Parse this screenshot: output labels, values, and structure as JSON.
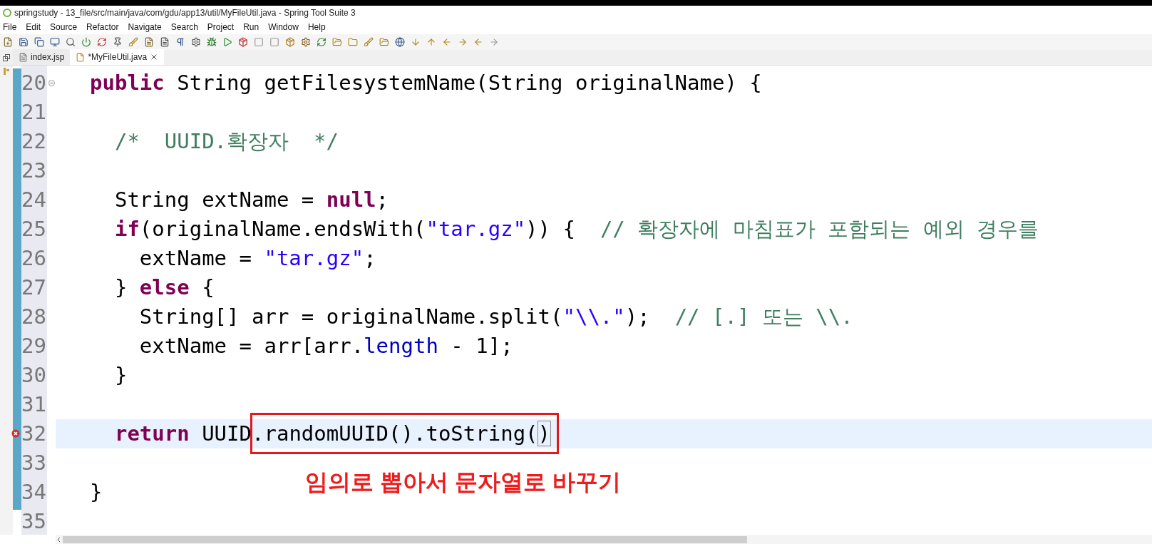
{
  "window": {
    "title": "springstudy - 13_file/src/main/java/com/gdu/app13/util/MyFileUtil.java - Spring Tool Suite 3"
  },
  "menu": [
    "File",
    "Edit",
    "Source",
    "Refactor",
    "Navigate",
    "Search",
    "Project",
    "Run",
    "Window",
    "Help"
  ],
  "tabs": [
    {
      "label": "index.jsp",
      "selected": false,
      "kind": "jsp"
    },
    {
      "label": "*MyFileUtil.java",
      "selected": true,
      "kind": "java"
    }
  ],
  "lines": [
    {
      "number": "20",
      "fold": true,
      "error": false,
      "current": false,
      "tokens": [
        {
          "t": "public",
          "kind": "keyword"
        },
        {
          "t": " String getFilesystemName(String originalName) {",
          "kind": "plain"
        }
      ]
    },
    {
      "number": "21",
      "fold": false,
      "error": false,
      "current": false
    },
    {
      "number": "22",
      "fold": false,
      "error": false,
      "current": false,
      "tokens": [
        {
          "t": "  /*  UUID.확장자  */",
          "kind": "comment"
        }
      ]
    },
    {
      "number": "23",
      "fold": false,
      "error": false,
      "current": false
    },
    {
      "number": "24",
      "fold": false,
      "error": false,
      "current": false,
      "tokens": [
        {
          "t": "  String extName = ",
          "kind": "plain"
        },
        {
          "t": "null",
          "kind": "keyword"
        },
        {
          "t": ";",
          "kind": "plain"
        }
      ]
    },
    {
      "number": "25",
      "fold": false,
      "error": false,
      "current": false,
      "tokens": [
        {
          "t": "  if",
          "kind": "keyword"
        },
        {
          "t": "(originalName.endsWith(",
          "kind": "plain"
        },
        {
          "t": "\"tar.gz\"",
          "kind": "string"
        },
        {
          "t": ")) {  ",
          "kind": "plain"
        },
        {
          "t": "// 확장자에 마침표가 포함되는 예외 경우를",
          "kind": "comment"
        }
      ]
    },
    {
      "number": "26",
      "fold": false,
      "error": false,
      "current": false,
      "tokens": [
        {
          "t": "    extName = ",
          "kind": "plain"
        },
        {
          "t": "\"tar.gz\"",
          "kind": "string"
        },
        {
          "t": ";",
          "kind": "plain"
        }
      ]
    },
    {
      "number": "27",
      "fold": false,
      "error": false,
      "current": false,
      "tokens": [
        {
          "t": "  } ",
          "kind": "plain"
        },
        {
          "t": "else",
          "kind": "keyword"
        },
        {
          "t": " {",
          "kind": "plain"
        }
      ]
    },
    {
      "number": "28",
      "fold": false,
      "error": false,
      "current": false,
      "tokens": [
        {
          "t": "    String[] arr = originalName.split(",
          "kind": "plain"
        },
        {
          "t": "\"\\\\.\"",
          "kind": "string"
        },
        {
          "t": ");  ",
          "kind": "plain"
        },
        {
          "t": "// [.] 또는 \\\\.",
          "kind": "comment"
        }
      ]
    },
    {
      "number": "29",
      "fold": false,
      "error": false,
      "current": false,
      "tokens": [
        {
          "t": "    extName = arr[arr.",
          "kind": "plain"
        },
        {
          "t": "length",
          "kind": "field"
        },
        {
          "t": " - 1];",
          "kind": "plain"
        }
      ]
    },
    {
      "number": "30",
      "fold": false,
      "error": false,
      "current": false,
      "tokens": [
        {
          "t": "  }",
          "kind": "plain"
        }
      ]
    },
    {
      "number": "31",
      "fold": false,
      "error": false,
      "current": false
    },
    {
      "number": "32",
      "fold": false,
      "error": true,
      "current": true,
      "tokens": [
        {
          "t": "  return",
          "kind": "keyword"
        },
        {
          "t": " UUID",
          "kind": "plain"
        }
      ],
      "boxed_tokens": [
        {
          "t": ".randomUUID().toString(",
          "kind": "plain"
        },
        {
          "t": ")",
          "kind": "bracket"
        }
      ]
    },
    {
      "number": "33",
      "fold": false,
      "error": false,
      "current": false
    },
    {
      "number": "34",
      "fold": false,
      "error": false,
      "current": false,
      "tokens": [
        {
          "t": "}",
          "kind": "plain"
        }
      ]
    },
    {
      "number": "35",
      "fold": false,
      "error": false,
      "current": false
    }
  ],
  "annotation": {
    "text": "임의로 뽑아서 문자열로 바꾸기"
  }
}
